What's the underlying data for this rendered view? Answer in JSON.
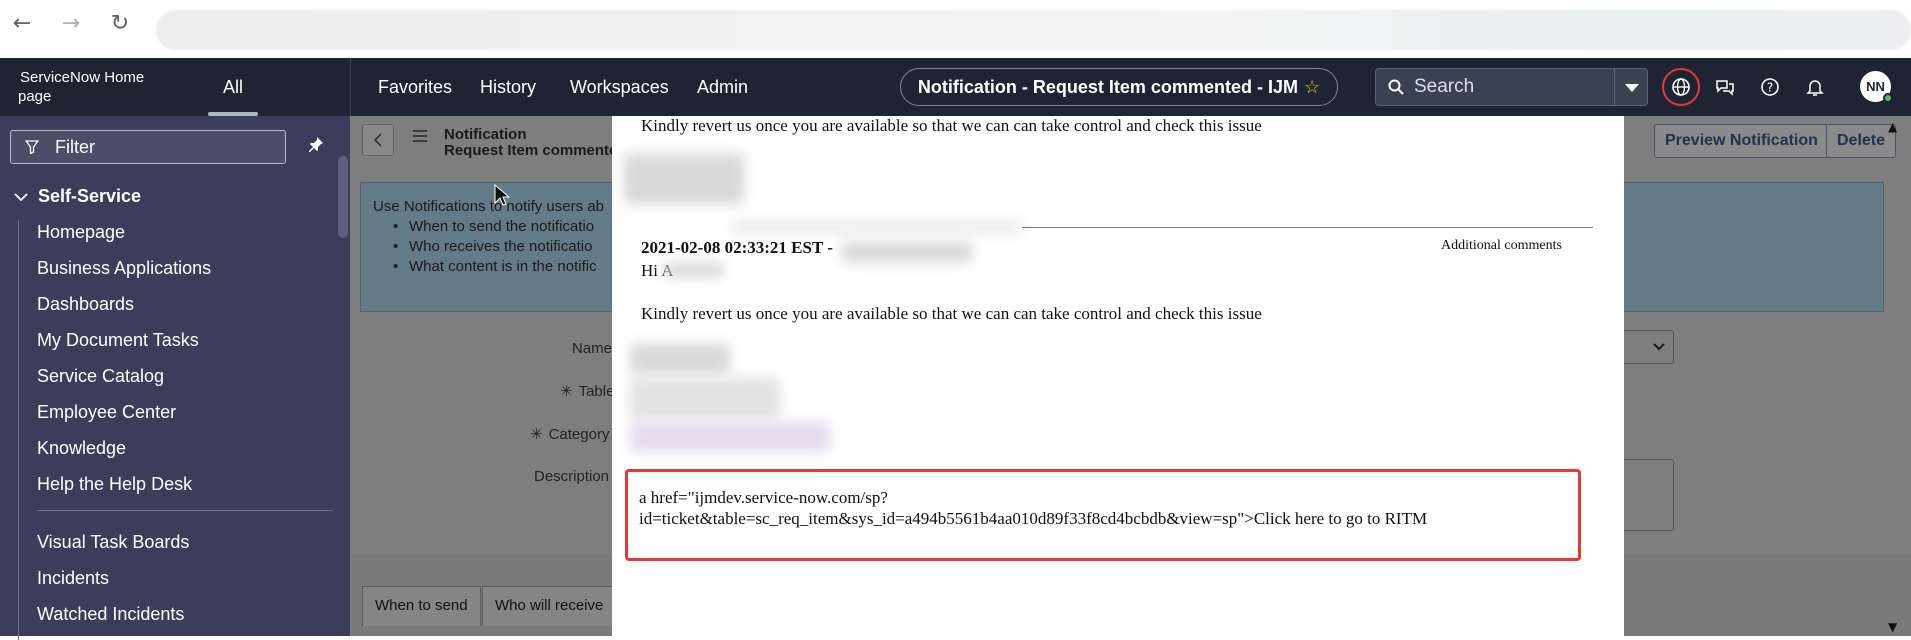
{
  "browser": {
    "back_glyph": "←",
    "forward_glyph": "→",
    "reload_glyph": "↻"
  },
  "header": {
    "logo_alt": "ServiceNow Home page",
    "all_label": "All",
    "menu": [
      "Favorites",
      "History",
      "Workspaces",
      "Admin"
    ],
    "record_title": "Notification - Request Item commented - IJM",
    "star_glyph": "☆",
    "search_placeholder": "Search",
    "avatar_initials": "NN"
  },
  "sidebar": {
    "filter_placeholder": "Filter",
    "section": "Self-Service",
    "items": [
      "Homepage",
      "Business Applications",
      "Dashboards",
      "My Document Tasks",
      "Service Catalog",
      "Employee Center",
      "Knowledge",
      "Help the Help Desk"
    ],
    "items2": [
      "Visual Task Boards",
      "Incidents",
      "Watched Incidents"
    ]
  },
  "main": {
    "breadcrumb_1": "Notification",
    "breadcrumb_2": "Request Item commente",
    "buttons": {
      "partial": "te",
      "preview": "Preview Notification",
      "delete": "Delete"
    },
    "info": {
      "intro": "Use Notifications to notify users ab",
      "bullets": [
        "When to send the notificatio",
        "Who receives the notificatio",
        "What content is in the notific"
      ]
    },
    "labels": {
      "name": "Name",
      "table": "Table",
      "category": "Category",
      "description": "Description"
    },
    "tabs": [
      "When to send",
      "Who will receive"
    ]
  },
  "preview": {
    "line_top": "Kindly revert us once you are available so that we can can take control and check this issue",
    "timestamp": "2021-02-08 02:33:21 EST -",
    "comment_type": "Additional comments",
    "greeting": "Hi A",
    "line_body": "Kindly revert us once you are available so that we can can take control and check this issue",
    "link_line1": "a href=\"ijmdev.service-now.com/sp?",
    "link_line2": "id=ticket&table=sc_req_item&sys_id=a494b5561b4aa010d89f33f8cd4bcbdb&view=sp\">Click here to go to RITM"
  },
  "colors": {
    "header_bg": "#1f2433",
    "sidebar_bg": "#3a3e5a",
    "highlight_border": "#e53935",
    "star": "#f1c40f"
  }
}
